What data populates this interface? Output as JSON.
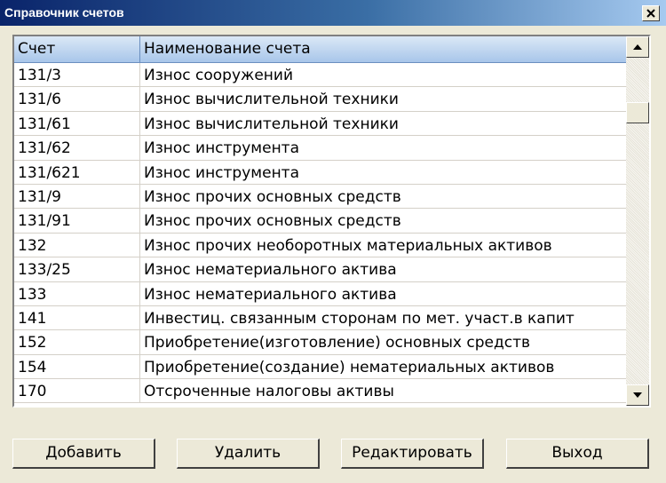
{
  "window": {
    "title": "Справочник счетов"
  },
  "table": {
    "headers": {
      "account": "Счет",
      "name": "Наименование счета"
    },
    "rows": [
      {
        "account": "131/3",
        "name": "Износ сооружений"
      },
      {
        "account": "131/6",
        "name": "Износ вычислительной техники"
      },
      {
        "account": "131/61",
        "name": "Износ вычислительной техники"
      },
      {
        "account": "131/62",
        "name": "Износ инструмента"
      },
      {
        "account": "131/621",
        "name": "Износ инструмента"
      },
      {
        "account": "131/9",
        "name": "Износ прочих основных средств"
      },
      {
        "account": "131/91",
        "name": "Износ прочих основных средств"
      },
      {
        "account": "132",
        "name": "Износ прочих необоротных материальных активов"
      },
      {
        "account": "133/25",
        "name": "Износ нематериального актива"
      },
      {
        "account": "133",
        "name": "Износ нематериального актива"
      },
      {
        "account": "141",
        "name": "Инвестиц. связанным сторонам по мет. участ.в капит"
      },
      {
        "account": "152",
        "name": "Приобретение(изготовление) основных средств"
      },
      {
        "account": "154",
        "name": "Приобретение(создание) нематериальных активов"
      },
      {
        "account": "170",
        "name": "Отсроченные налоговы активы"
      }
    ]
  },
  "buttons": {
    "add": "Добавить",
    "delete": "Удалить",
    "edit": "Редактировать",
    "exit": "Выход"
  },
  "icons": {
    "close": "close-icon",
    "scroll_up": "arrow-up-icon",
    "scroll_down": "arrow-down-icon"
  },
  "colors": {
    "title_bar_start": "#0a246a",
    "title_bar_end": "#a6caf0",
    "header_bg": "#a8c6ea",
    "dialog_bg": "#ece9d8"
  }
}
